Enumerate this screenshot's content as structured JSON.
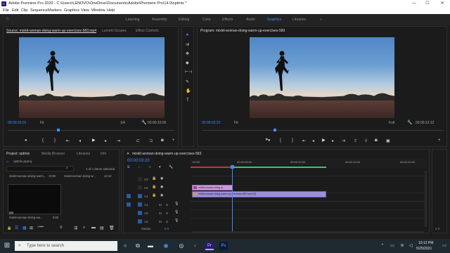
{
  "window": {
    "title": "Adobe Premiere Pro 2020 - C:\\Users\\LENOVO\\OneDrive\\Documents\\Adobe\\Premiere Pro\\14.0\\optmix *",
    "app_icon": "Pr",
    "controls": [
      "—",
      "☐",
      "✕"
    ]
  },
  "menu": [
    "File",
    "Edit",
    "Clip",
    "Sequence",
    "Markers",
    "Graphics",
    "View",
    "Window",
    "Help"
  ],
  "workspaces": {
    "home_icon": "home-icon",
    "items": [
      "Learning",
      "Assembly",
      "Editing",
      "Color",
      "Effects",
      "Audio",
      "Graphics",
      "Libraries"
    ],
    "active": "Graphics",
    "more": "»"
  },
  "source": {
    "tabs": [
      "Source: mixkit-woman-doing-warm-up-exercises-583.mp4",
      "Lumetri Scopes",
      "Effect Controls"
    ],
    "timecode": "00:00:03:01",
    "fit": "Fit",
    "page": "1/4",
    "duration": "00:00:10:00"
  },
  "program": {
    "tabs": [
      "Program: mixkit-woman-doing-warm-up-exercises-583"
    ],
    "timecode": "00:00:03:20",
    "fit": "Fit",
    "quality": "Full",
    "duration": "00:00:12:12"
  },
  "project": {
    "tabs": [
      "Project: optmix",
      "Media Browser",
      "Libraries",
      "Info"
    ],
    "path": "optmix.prproj",
    "selection": "1 of 1 items selected",
    "items": [
      {
        "name": "mixkit-woman-doing-warm...",
        "duration": "10:00"
      },
      {
        "name": "mixkit-woman-doing-w...",
        "duration": "12:12"
      }
    ],
    "thumb_label": "mixkit-woman-doing-wa...",
    "thumb_duration": "5:00"
  },
  "timeline": {
    "tab": "mixkit-woman-doing-warm-up-exercises-583",
    "timecode": "00:00:03:20",
    "ruler": [
      ":00:00",
      "00:00:05:00",
      "00:00:10:00",
      "00:00:15:00",
      "00:00:20:00"
    ],
    "tracks_video": [
      "V3",
      "V2",
      "V1"
    ],
    "tracks_audio": [
      "A1",
      "A2",
      "A3"
    ],
    "master": "Master",
    "master_value": "0.0",
    "video_clip": "mixkit-woman-doing-w...",
    "audio_clip": "mixkit-woman-doing-warm-up-exercises-583.mp4 [V]"
  },
  "taskbar": {
    "search_placeholder": "Type here to search",
    "time": "10:12 PM",
    "date": "5/25/2021"
  },
  "colors": {
    "accent": "#3f8cff",
    "video_clip": "#c79bdb",
    "audio_clip": "#9b8fd9"
  }
}
